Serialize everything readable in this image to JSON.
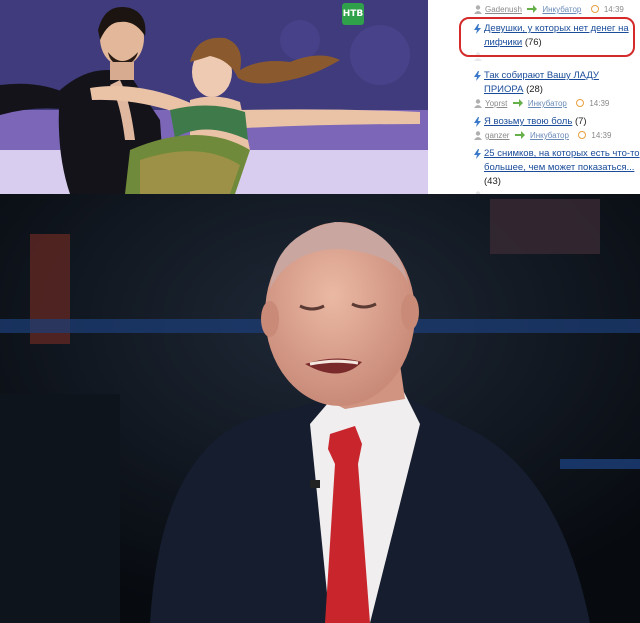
{
  "top_photo": {
    "channel_logo": "НТВ"
  },
  "sidebar": {
    "entries": [
      {
        "title": "",
        "count": "",
        "user": "Gadenush",
        "category": "Инкубатор",
        "time": "14:39"
      },
      {
        "title": "Девушки, у которых нет денег на лифчики",
        "count": "(76)",
        "user": "",
        "category": "",
        "time": ""
      },
      {
        "title": "Так собирают Вашу ЛАДУ ПРИОРА",
        "count": "(28)",
        "user": "Yoprst",
        "category": "Инкубатор",
        "time": "14:39"
      },
      {
        "title": "Я возьму твою боль",
        "count": "(7)",
        "user": "ganzer",
        "category": "Инкубатор",
        "time": "14:39"
      },
      {
        "title": "25 снимков, на которых есть что-то большее, чем может показаться...",
        "count": "(43)",
        "user": "",
        "category": "",
        "time": ""
      }
    ],
    "highlight_color": "#d42a2a",
    "link_color": "#1a4c9a"
  }
}
